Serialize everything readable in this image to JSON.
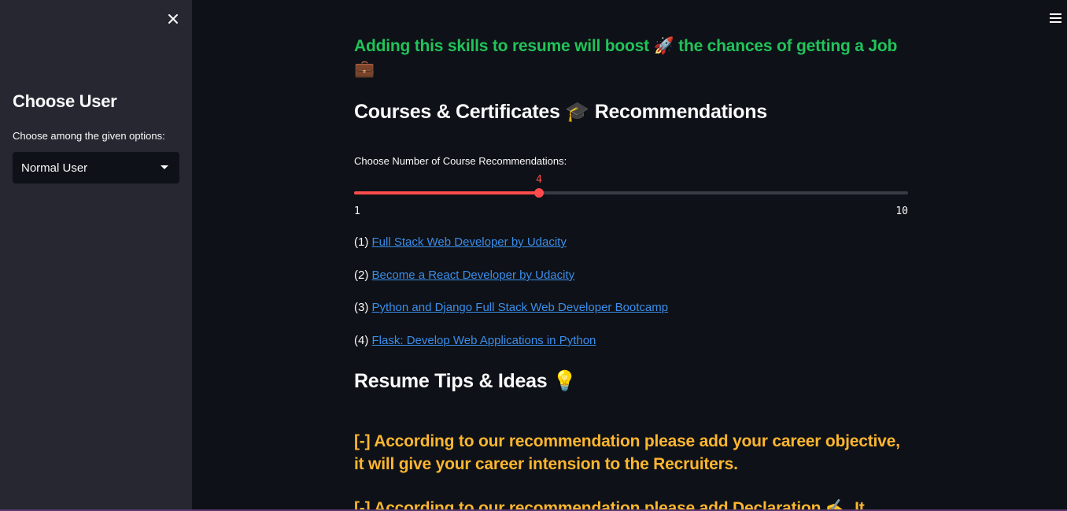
{
  "sidebar": {
    "close_icon": "close-icon",
    "title": "Choose User",
    "select_label": "Choose among the given options:",
    "select_value": "Normal User"
  },
  "header": {
    "menu_icon": "hamburger-menu-icon"
  },
  "main": {
    "boost_text_a": "Adding this skills to resume will boost",
    "boost_emoji_1": "🚀",
    "boost_text_b": " the chances of getting a Job",
    "boost_emoji_2": "💼",
    "courses_heading_a": "Courses & Certificates",
    "courses_emoji": "🎓",
    "courses_heading_b": " Recommendations",
    "slider": {
      "label": "Choose Number of Course Recommendations:",
      "value": 4,
      "value_text": "4",
      "min": 1,
      "max": 10,
      "min_text": "1",
      "max_text": "10"
    },
    "courses": [
      {
        "num": "(1)",
        "title": "Full Stack Web Developer by Udacity"
      },
      {
        "num": "(2)",
        "title": "Become a React Developer by Udacity"
      },
      {
        "num": "(3)",
        "title": "Python and Django Full Stack Web Developer Bootcamp"
      },
      {
        "num": "(4)",
        "title": "Flask: Develop Web Applications in Python"
      }
    ],
    "tips_heading": "Resume Tips & Ideas",
    "tips_emoji": "💡",
    "tips": [
      "[-] According to our recommendation please add your career objective, it will give your career intension to the Recruiters.",
      "[-] According to our recommendation please add Declaration ✍. It"
    ]
  },
  "colors": {
    "background": "#0e1117",
    "sidebar": "#262730",
    "accent": "#ff4b4b",
    "success_green": "#21c35a",
    "tip_orange": "#fdb62f",
    "link_blue": "#3b8eea"
  }
}
